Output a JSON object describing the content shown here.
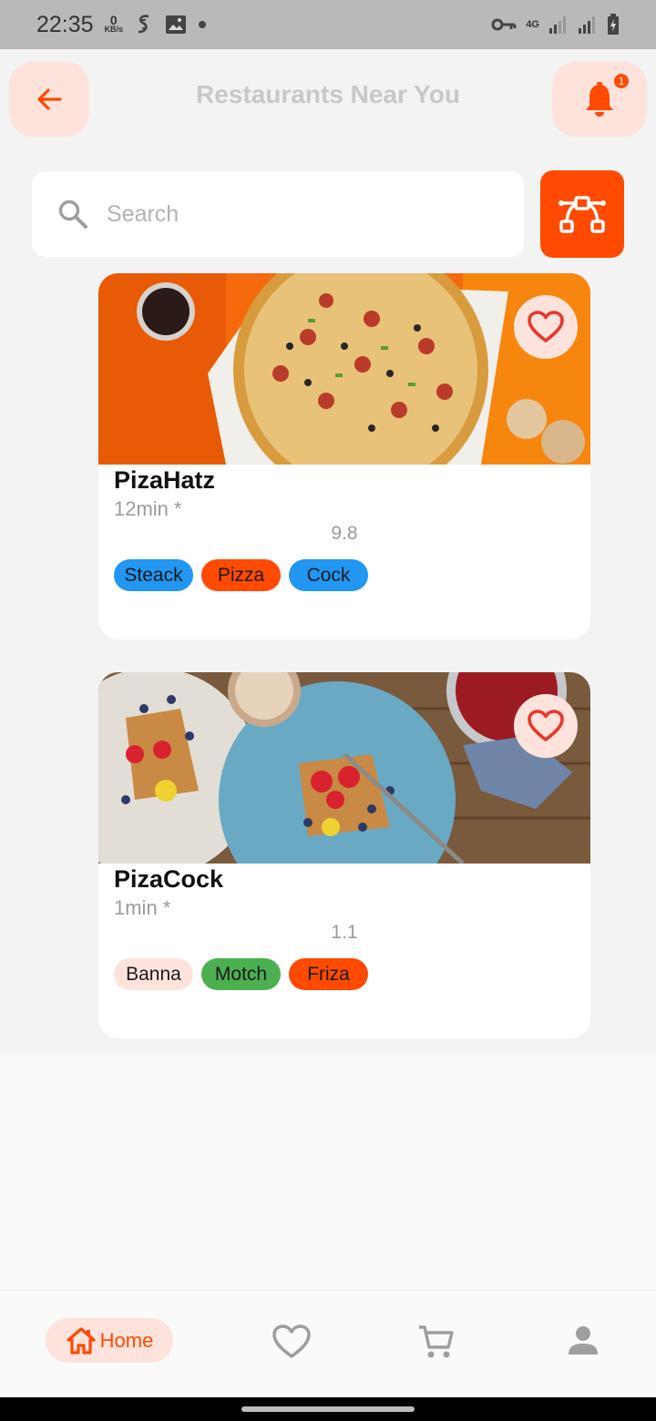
{
  "status_bar": {
    "time": "22:35",
    "speed_value": "0",
    "speed_unit": "KB/s",
    "network": "4G"
  },
  "header": {
    "title": "Restaurants Near You",
    "notification_count": "1"
  },
  "search": {
    "placeholder": "Search",
    "value": ""
  },
  "restaurants": [
    {
      "name": "PizaHatz",
      "time": "12min *",
      "rating": "9.8",
      "tags": [
        {
          "label": "Steack",
          "color": "#2196f3"
        },
        {
          "label": "Pizza",
          "color": "#ff4a00"
        },
        {
          "label": "Cock",
          "color": "#2196f3"
        }
      ]
    },
    {
      "name": "PizaCock",
      "time": "1min *",
      "rating": "1.1",
      "tags": [
        {
          "label": "Banna",
          "color": "#fde3dc"
        },
        {
          "label": "Motch",
          "color": "#4caf50"
        },
        {
          "label": "Friza",
          "color": "#ff4a00"
        }
      ]
    }
  ],
  "bottom_nav": {
    "home_label": "Home",
    "items": [
      "home-icon",
      "heart-icon",
      "cart-icon",
      "person-icon"
    ]
  },
  "colors": {
    "accent": "#ff4a00",
    "accent_soft": "#fde3dc",
    "background": "#f3f3f3"
  }
}
